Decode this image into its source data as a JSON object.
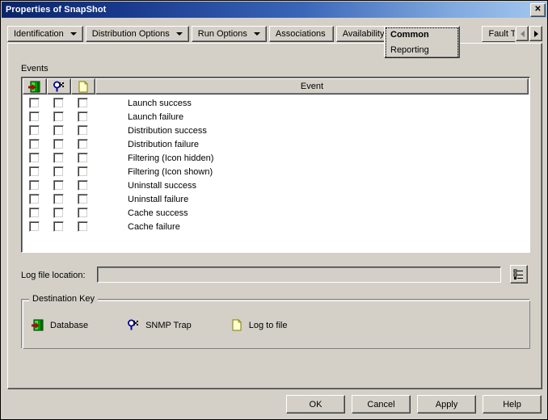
{
  "window": {
    "title": "Properties of SnapShot",
    "close_label": "✕"
  },
  "tabs": {
    "items": [
      {
        "label": "Identification",
        "has_dropdown": true,
        "active": false
      },
      {
        "label": "Distribution Options",
        "has_dropdown": true,
        "active": false
      },
      {
        "label": "Run Options",
        "has_dropdown": true,
        "active": false
      },
      {
        "label": "Associations",
        "has_dropdown": false,
        "active": false
      },
      {
        "label": "Availability",
        "has_dropdown": true,
        "active": false
      },
      {
        "label": "Fault Toleranc",
        "has_dropdown": false,
        "active": false
      }
    ],
    "active_tab": {
      "label": "Common",
      "submenu_item": "Reporting"
    },
    "scroll_left_icon": "arrow-left-icon",
    "scroll_right_icon": "arrow-right-icon"
  },
  "events": {
    "group_label": "Events",
    "columns": [
      {
        "icon": "database-icon",
        "title": "Database"
      },
      {
        "icon": "snmp-trap-icon",
        "title": "SNMP Trap"
      },
      {
        "icon": "log-file-icon",
        "title": "Log to file"
      }
    ],
    "event_column_header": "Event",
    "rows": [
      {
        "name": "Launch success",
        "database": false,
        "snmp": false,
        "logfile": false
      },
      {
        "name": "Launch failure",
        "database": false,
        "snmp": false,
        "logfile": false
      },
      {
        "name": "Distribution success",
        "database": false,
        "snmp": false,
        "logfile": false
      },
      {
        "name": "Distribution failure",
        "database": false,
        "snmp": false,
        "logfile": false
      },
      {
        "name": "Filtering (Icon hidden)",
        "database": false,
        "snmp": false,
        "logfile": false
      },
      {
        "name": "Filtering (Icon shown)",
        "database": false,
        "snmp": false,
        "logfile": false
      },
      {
        "name": "Uninstall success",
        "database": false,
        "snmp": false,
        "logfile": false
      },
      {
        "name": "Uninstall failure",
        "database": false,
        "snmp": false,
        "logfile": false
      },
      {
        "name": "Cache success",
        "database": false,
        "snmp": false,
        "logfile": false
      },
      {
        "name": "Cache failure",
        "database": false,
        "snmp": false,
        "logfile": false
      }
    ]
  },
  "logfile": {
    "label": "Log file location:",
    "value": "",
    "placeholder": "",
    "browse_icon": "tree-browse-icon"
  },
  "destination_key": {
    "title": "Destination Key",
    "items": [
      {
        "icon": "database-icon",
        "label": "Database"
      },
      {
        "icon": "snmp-trap-icon",
        "label": "SNMP Trap"
      },
      {
        "icon": "log-file-icon",
        "label": "Log to file"
      }
    ]
  },
  "buttons": {
    "ok": "OK",
    "cancel": "Cancel",
    "apply": "Apply",
    "help": "Help"
  },
  "colors": {
    "face": "#d4d0c8",
    "title_dark": "#0a246a",
    "title_light": "#a6c8f0",
    "list_bg": "#ffffff",
    "database_green": "#009900",
    "database_arrow_red": "#cc0000",
    "snmp_blue": "#000099",
    "logfile_cream": "#ffffcc"
  }
}
